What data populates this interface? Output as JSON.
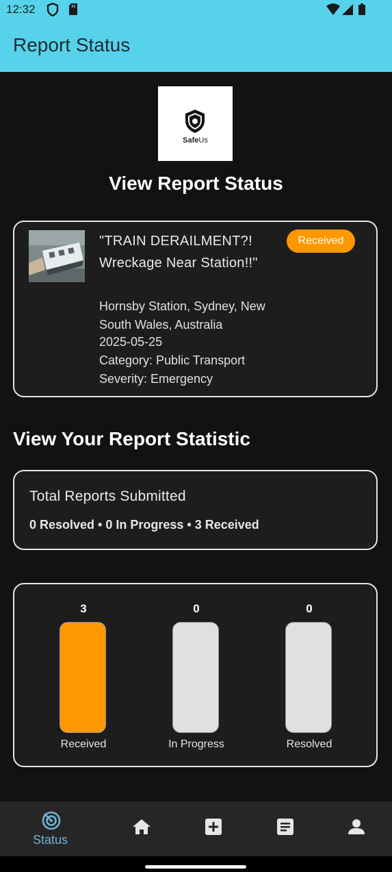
{
  "status_bar": {
    "time": "12:32"
  },
  "app_bar": {
    "title": "Report Status"
  },
  "logo": {
    "brand_bold": "Safe",
    "brand_rest": "Us"
  },
  "page_heading": "View Report Status",
  "report": {
    "title": "\"TRAIN DERAILMENT?! Wreckage Near Station!!\"",
    "location": "Hornsby Station, Sydney, New South Wales, Australia",
    "date": "2025-05-25",
    "category": "Category: Public Transport",
    "severity": "Severity: Emergency",
    "status_badge": "Received"
  },
  "statistic_heading": "View Your Report Statistic",
  "totals": {
    "title": "Total Reports Submitted",
    "summary": "0 Resolved • 0 In Progress • 3 Received"
  },
  "chart_data": {
    "type": "bar",
    "categories": [
      "Received",
      "In Progress",
      "Resolved"
    ],
    "values": [
      3,
      0,
      0
    ],
    "colors": [
      "#ff9800",
      "#e0e0e0",
      "#e0e0e0"
    ],
    "ylim": [
      0,
      3
    ]
  },
  "nav": {
    "items": [
      {
        "label": "Status",
        "icon": "radar-icon",
        "active": true
      },
      {
        "label": "",
        "icon": "home-icon"
      },
      {
        "label": "",
        "icon": "add-box-icon"
      },
      {
        "label": "",
        "icon": "article-icon"
      },
      {
        "label": "",
        "icon": "person-icon"
      }
    ]
  },
  "colors": {
    "accent": "#56d3ea",
    "badge": "#ff9800",
    "nav_active": "#6fb4d6"
  }
}
